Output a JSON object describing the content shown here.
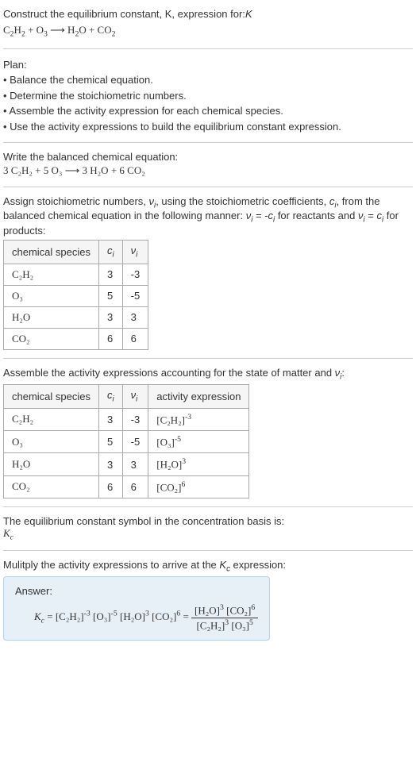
{
  "intro": {
    "line1": "Construct the equilibrium constant, K, expression for:",
    "eq_lhs1": "C",
    "eq_lhs1_sub": "2",
    "eq_lhs2": "H",
    "eq_lhs2_sub": "2",
    "eq_plus1": " + O",
    "eq_lhs3_sub": "3",
    "eq_arrow": " ⟶ H",
    "eq_rhs1_sub": "2",
    "eq_rhs2": "O + CO",
    "eq_rhs2_sub": "2"
  },
  "plan": {
    "title": "Plan:",
    "items": [
      "• Balance the chemical equation.",
      "• Determine the stoichiometric numbers.",
      "• Assemble the activity expression for each chemical species.",
      "• Use the activity expressions to build the equilibrium constant expression."
    ]
  },
  "balanced": {
    "intro": "Write the balanced chemical equation:",
    "text": "3 C₂H₂ + 5 O₃ ⟶ 3 H₂O + 6 CO₂"
  },
  "stoich": {
    "intro_p1": "Assign stoichiometric numbers, ",
    "intro_nu": "ν",
    "intro_sub_i": "i",
    "intro_p2": ", using the stoichiometric coefficients, ",
    "intro_c": "c",
    "intro_p3": ", from the balanced chemical equation in the following manner: ",
    "intro_eq1": " = -",
    "intro_p4": " for reactants and ",
    "intro_eq2": " = ",
    "intro_p5": " for products:",
    "headers": {
      "species": "chemical species",
      "ci": "cᵢ",
      "nui": "νᵢ"
    },
    "rows": [
      {
        "species": "C₂H₂",
        "ci": "3",
        "nui": "-3"
      },
      {
        "species": "O₃",
        "ci": "5",
        "nui": "-5"
      },
      {
        "species": "H₂O",
        "ci": "3",
        "nui": "3"
      },
      {
        "species": "CO₂",
        "ci": "6",
        "nui": "6"
      }
    ]
  },
  "activity": {
    "intro_p1": "Assemble the activity expressions accounting for the state of matter and ",
    "intro_p2": ":",
    "headers": {
      "species": "chemical species",
      "ci": "cᵢ",
      "nui": "νᵢ",
      "expr": "activity expression"
    },
    "rows": [
      {
        "species": "C₂H₂",
        "ci": "3",
        "nui": "-3",
        "expr": "[C₂H₂]",
        "exp": "-3"
      },
      {
        "species": "O₃",
        "ci": "5",
        "nui": "-5",
        "expr": "[O₃]",
        "exp": "-5"
      },
      {
        "species": "H₂O",
        "ci": "3",
        "nui": "3",
        "expr": "[H₂O]",
        "exp": "3"
      },
      {
        "species": "CO₂",
        "ci": "6",
        "nui": "6",
        "expr": "[CO₂]",
        "exp": "6"
      }
    ]
  },
  "symbol": {
    "intro": "The equilibrium constant symbol in the concentration basis is:",
    "K": "K",
    "sub": "c"
  },
  "multiply": {
    "intro_p1": "Mulitply the activity expressions to arrive at the ",
    "intro_p2": " expression:"
  },
  "answer": {
    "label": "Answer:",
    "Kc": "K",
    "Kc_sub": "c",
    "eq": " = ",
    "t1": "[C₂H₂]",
    "e1": "-3",
    "t2": " [O₃]",
    "e2": "-5",
    "t3": " [H₂O]",
    "e3": "3",
    "t4": " [CO₂]",
    "e4": "6",
    "eq2": " = ",
    "num1": "[H₂O]",
    "num1e": "3",
    "num2": " [CO₂]",
    "num2e": "6",
    "den1": "[C₂H₂]",
    "den1e": "3",
    "den2": " [O₃]",
    "den2e": "5"
  }
}
